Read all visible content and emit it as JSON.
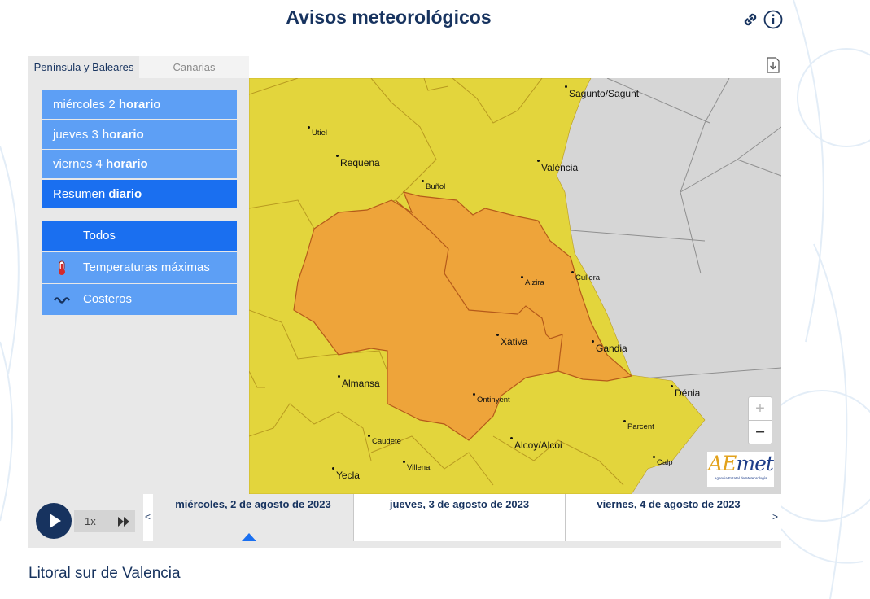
{
  "header": {
    "title": "Avisos meteorológicos",
    "link_icon": "link-icon",
    "info_icon": "info-icon"
  },
  "region_tabs": [
    {
      "label": "Península y Baleares",
      "active": true
    },
    {
      "label": "Canarias",
      "active": false
    }
  ],
  "day_menu": [
    {
      "day": "miércoles 2",
      "suffix": "horario",
      "selected": false
    },
    {
      "day": "jueves 3",
      "suffix": "horario",
      "selected": false
    },
    {
      "day": "viernes 4",
      "suffix": "horario",
      "selected": false
    },
    {
      "day": "Resumen",
      "suffix": "diario",
      "selected": true
    }
  ],
  "filters": [
    {
      "label": "Todos",
      "icon": "",
      "selected": true
    },
    {
      "label": "Temperaturas máximas",
      "icon": "thermometer-icon",
      "selected": false
    },
    {
      "label": "Costeros",
      "icon": "waves-icon",
      "selected": false
    }
  ],
  "map": {
    "towns": [
      {
        "name": "Sagunto/Sagunt",
        "size": "normal"
      },
      {
        "name": "Utiel",
        "size": "small"
      },
      {
        "name": "Requena",
        "size": "normal"
      },
      {
        "name": "València",
        "size": "normal"
      },
      {
        "name": "Buñol",
        "size": "small"
      },
      {
        "name": "Alzira",
        "size": "small"
      },
      {
        "name": "Cullera",
        "size": "small"
      },
      {
        "name": "Xàtiva",
        "size": "normal"
      },
      {
        "name": "Gandia",
        "size": "normal"
      },
      {
        "name": "Almansa",
        "size": "normal"
      },
      {
        "name": "Dénia",
        "size": "normal"
      },
      {
        "name": "Ontinyent",
        "size": "small"
      },
      {
        "name": "Parcent",
        "size": "small"
      },
      {
        "name": "Caudete",
        "size": "small"
      },
      {
        "name": "Alcoy/Alcoi",
        "size": "normal"
      },
      {
        "name": "Villena",
        "size": "small"
      },
      {
        "name": "Calp",
        "size": "small"
      },
      {
        "name": "Yecla",
        "size": "normal"
      }
    ],
    "colors": {
      "yellow_warning": "#e3d53c",
      "orange_warning": "#eea43a",
      "sea": "#d6d6d6",
      "border": "#b89a20"
    },
    "zoom_in": "+",
    "zoom_out": "−",
    "logo_text_a": "A",
    "logo_text_e": "E",
    "logo_text_rest": "met",
    "logo_subtitle": "Agencia Estatal de Meteorología"
  },
  "timeline": {
    "speed": "1x",
    "days": [
      {
        "label": "miércoles, 2 de agosto de 2023",
        "active": true
      },
      {
        "label": "jueves, 3 de agosto de 2023",
        "active": false
      },
      {
        "label": "viernes, 4 de agosto de 2023",
        "active": false
      }
    ],
    "prev": "<",
    "next": ">"
  },
  "section": {
    "title": "Litoral sur de Valencia"
  }
}
